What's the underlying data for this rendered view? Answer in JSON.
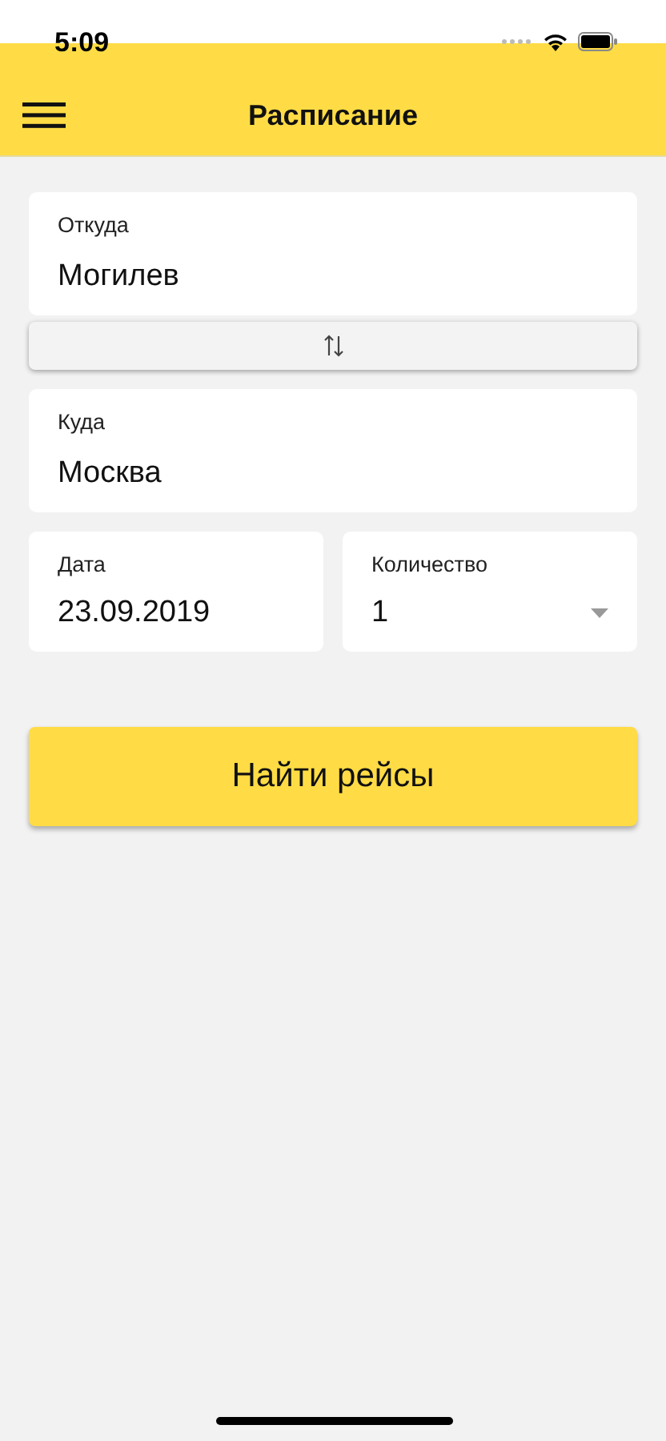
{
  "status_bar": {
    "time": "5:09"
  },
  "header": {
    "title": "Расписание"
  },
  "fields": [
    {
      "kind": "text",
      "label": "Откуда",
      "value": "Могилев"
    },
    {
      "kind": "swap"
    },
    {
      "kind": "text",
      "label": "Куда",
      "value": "Москва"
    }
  ],
  "row_fields": [
    {
      "kind": "text",
      "label": "Дата",
      "value": "23.09.2019"
    },
    {
      "kind": "select",
      "label": "Количество",
      "value": "1"
    }
  ],
  "search_button": "Найти рейсы"
}
